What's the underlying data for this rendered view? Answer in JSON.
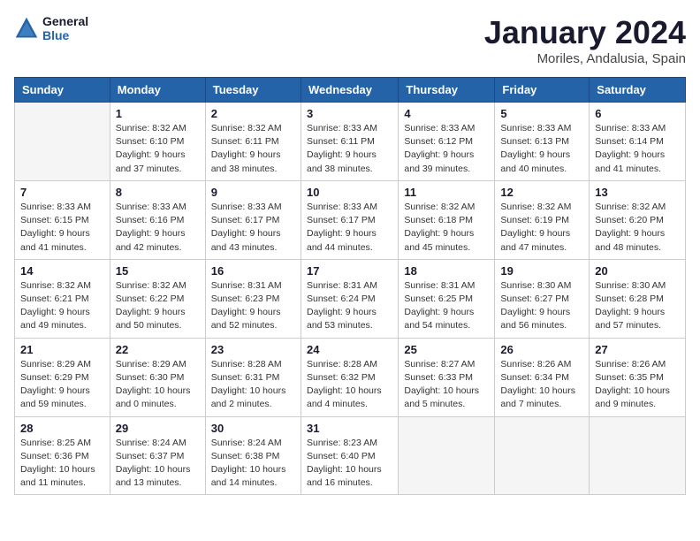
{
  "logo": {
    "text1": "General",
    "text2": "Blue"
  },
  "title": "January 2024",
  "subtitle": "Moriles, Andalusia, Spain",
  "headers": [
    "Sunday",
    "Monday",
    "Tuesday",
    "Wednesday",
    "Thursday",
    "Friday",
    "Saturday"
  ],
  "weeks": [
    [
      {
        "day": "",
        "info": ""
      },
      {
        "day": "1",
        "info": "Sunrise: 8:32 AM\nSunset: 6:10 PM\nDaylight: 9 hours\nand 37 minutes."
      },
      {
        "day": "2",
        "info": "Sunrise: 8:32 AM\nSunset: 6:11 PM\nDaylight: 9 hours\nand 38 minutes."
      },
      {
        "day": "3",
        "info": "Sunrise: 8:33 AM\nSunset: 6:11 PM\nDaylight: 9 hours\nand 38 minutes."
      },
      {
        "day": "4",
        "info": "Sunrise: 8:33 AM\nSunset: 6:12 PM\nDaylight: 9 hours\nand 39 minutes."
      },
      {
        "day": "5",
        "info": "Sunrise: 8:33 AM\nSunset: 6:13 PM\nDaylight: 9 hours\nand 40 minutes."
      },
      {
        "day": "6",
        "info": "Sunrise: 8:33 AM\nSunset: 6:14 PM\nDaylight: 9 hours\nand 41 minutes."
      }
    ],
    [
      {
        "day": "7",
        "info": "Sunrise: 8:33 AM\nSunset: 6:15 PM\nDaylight: 9 hours\nand 41 minutes."
      },
      {
        "day": "8",
        "info": "Sunrise: 8:33 AM\nSunset: 6:16 PM\nDaylight: 9 hours\nand 42 minutes."
      },
      {
        "day": "9",
        "info": "Sunrise: 8:33 AM\nSunset: 6:17 PM\nDaylight: 9 hours\nand 43 minutes."
      },
      {
        "day": "10",
        "info": "Sunrise: 8:33 AM\nSunset: 6:17 PM\nDaylight: 9 hours\nand 44 minutes."
      },
      {
        "day": "11",
        "info": "Sunrise: 8:32 AM\nSunset: 6:18 PM\nDaylight: 9 hours\nand 45 minutes."
      },
      {
        "day": "12",
        "info": "Sunrise: 8:32 AM\nSunset: 6:19 PM\nDaylight: 9 hours\nand 47 minutes."
      },
      {
        "day": "13",
        "info": "Sunrise: 8:32 AM\nSunset: 6:20 PM\nDaylight: 9 hours\nand 48 minutes."
      }
    ],
    [
      {
        "day": "14",
        "info": "Sunrise: 8:32 AM\nSunset: 6:21 PM\nDaylight: 9 hours\nand 49 minutes."
      },
      {
        "day": "15",
        "info": "Sunrise: 8:32 AM\nSunset: 6:22 PM\nDaylight: 9 hours\nand 50 minutes."
      },
      {
        "day": "16",
        "info": "Sunrise: 8:31 AM\nSunset: 6:23 PM\nDaylight: 9 hours\nand 52 minutes."
      },
      {
        "day": "17",
        "info": "Sunrise: 8:31 AM\nSunset: 6:24 PM\nDaylight: 9 hours\nand 53 minutes."
      },
      {
        "day": "18",
        "info": "Sunrise: 8:31 AM\nSunset: 6:25 PM\nDaylight: 9 hours\nand 54 minutes."
      },
      {
        "day": "19",
        "info": "Sunrise: 8:30 AM\nSunset: 6:27 PM\nDaylight: 9 hours\nand 56 minutes."
      },
      {
        "day": "20",
        "info": "Sunrise: 8:30 AM\nSunset: 6:28 PM\nDaylight: 9 hours\nand 57 minutes."
      }
    ],
    [
      {
        "day": "21",
        "info": "Sunrise: 8:29 AM\nSunset: 6:29 PM\nDaylight: 9 hours\nand 59 minutes."
      },
      {
        "day": "22",
        "info": "Sunrise: 8:29 AM\nSunset: 6:30 PM\nDaylight: 10 hours\nand 0 minutes."
      },
      {
        "day": "23",
        "info": "Sunrise: 8:28 AM\nSunset: 6:31 PM\nDaylight: 10 hours\nand 2 minutes."
      },
      {
        "day": "24",
        "info": "Sunrise: 8:28 AM\nSunset: 6:32 PM\nDaylight: 10 hours\nand 4 minutes."
      },
      {
        "day": "25",
        "info": "Sunrise: 8:27 AM\nSunset: 6:33 PM\nDaylight: 10 hours\nand 5 minutes."
      },
      {
        "day": "26",
        "info": "Sunrise: 8:26 AM\nSunset: 6:34 PM\nDaylight: 10 hours\nand 7 minutes."
      },
      {
        "day": "27",
        "info": "Sunrise: 8:26 AM\nSunset: 6:35 PM\nDaylight: 10 hours\nand 9 minutes."
      }
    ],
    [
      {
        "day": "28",
        "info": "Sunrise: 8:25 AM\nSunset: 6:36 PM\nDaylight: 10 hours\nand 11 minutes."
      },
      {
        "day": "29",
        "info": "Sunrise: 8:24 AM\nSunset: 6:37 PM\nDaylight: 10 hours\nand 13 minutes."
      },
      {
        "day": "30",
        "info": "Sunrise: 8:24 AM\nSunset: 6:38 PM\nDaylight: 10 hours\nand 14 minutes."
      },
      {
        "day": "31",
        "info": "Sunrise: 8:23 AM\nSunset: 6:40 PM\nDaylight: 10 hours\nand 16 minutes."
      },
      {
        "day": "",
        "info": ""
      },
      {
        "day": "",
        "info": ""
      },
      {
        "day": "",
        "info": ""
      }
    ]
  ]
}
